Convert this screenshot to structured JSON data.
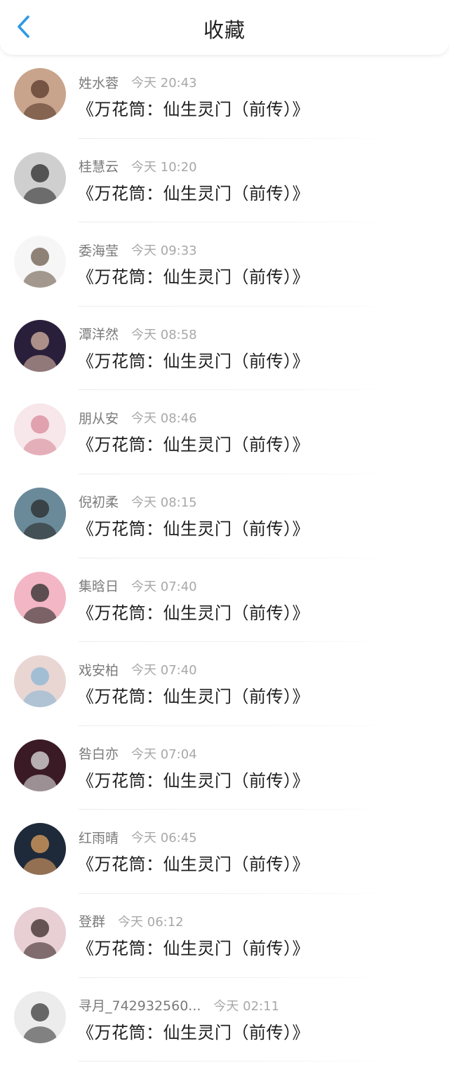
{
  "header": {
    "title": "收藏",
    "back_icon": "chevron-left-icon",
    "accent": "#2f9ae6"
  },
  "favorites": [
    {
      "name": "姓水蓉",
      "time": "今天 20:43",
      "title": "《万花筒：仙生灵门（前传）》",
      "avatar_bg": "#c9a48c",
      "avatar_fg": "#5a3a2c"
    },
    {
      "name": "桂慧云",
      "time": "今天 10:20",
      "title": "《万花筒：仙生灵门（前传）》",
      "avatar_bg": "#cfcfcf",
      "avatar_fg": "#2a2a2a"
    },
    {
      "name": "委海莹",
      "time": "今天 09:33",
      "title": "《万花筒：仙生灵门（前传）》",
      "avatar_bg": "#f6f6f6",
      "avatar_fg": "#6b5a4a"
    },
    {
      "name": "潭洋然",
      "time": "今天 08:58",
      "title": "《万花筒：仙生灵门（前传）》",
      "avatar_bg": "#2a1f3a",
      "avatar_fg": "#d9b6a4"
    },
    {
      "name": "朋从安",
      "time": "今天 08:46",
      "title": "《万花筒：仙生灵门（前传）》",
      "avatar_bg": "#f7e6ea",
      "avatar_fg": "#d98a9a"
    },
    {
      "name": "倪初柔",
      "time": "今天 08:15",
      "title": "《万花筒：仙生灵门（前传）》",
      "avatar_bg": "#6a8a9a",
      "avatar_fg": "#2a2a2a"
    },
    {
      "name": "集晗日",
      "time": "今天 07:40",
      "title": "《万花筒：仙生灵门（前传）》",
      "avatar_bg": "#f3b6c4",
      "avatar_fg": "#2a2a2a"
    },
    {
      "name": "戏安柏",
      "time": "今天 07:40",
      "title": "《万花筒：仙生灵门（前传）》",
      "avatar_bg": "#e9d6d2",
      "avatar_fg": "#8ab6d6"
    },
    {
      "name": "咎白亦",
      "time": "今天 07:04",
      "title": "《万花筒：仙生灵门（前传）》",
      "avatar_bg": "#3a1a24",
      "avatar_fg": "#e0e0e0"
    },
    {
      "name": "红雨晴",
      "time": "今天 06:45",
      "title": "《万花筒：仙生灵门（前传）》",
      "avatar_bg": "#1e2a3a",
      "avatar_fg": "#e0a060"
    },
    {
      "name": "登群",
      "time": "今天 06:12",
      "title": "《万花筒：仙生灵门（前传）》",
      "avatar_bg": "#e8cfd4",
      "avatar_fg": "#3a2a2a"
    },
    {
      "name": "寻月_742932560...",
      "time": "今天 02:11",
      "title": "《万花筒：仙生灵门（前传）》",
      "avatar_bg": "#ececec",
      "avatar_fg": "#3a3a3a"
    }
  ]
}
